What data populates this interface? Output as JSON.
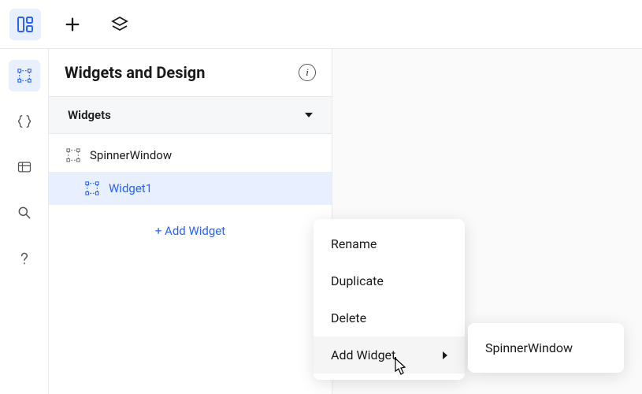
{
  "topbar": {
    "items": [
      {
        "name": "layout-icon",
        "active": true
      },
      {
        "name": "plus-icon",
        "active": false
      },
      {
        "name": "layers-icon",
        "active": false
      }
    ]
  },
  "sidebar": {
    "items": [
      {
        "name": "design-icon",
        "active": true
      },
      {
        "name": "code-icon",
        "active": false
      },
      {
        "name": "table-icon",
        "active": false
      },
      {
        "name": "search-icon",
        "active": false
      },
      {
        "name": "help-icon",
        "active": false
      }
    ]
  },
  "panel": {
    "title": "Widgets and Design",
    "info_char": "i",
    "section": {
      "title": "Widgets",
      "expanded": true
    },
    "tree": [
      {
        "label": "SpinnerWindow",
        "selected": false,
        "level": 0
      },
      {
        "label": "Widget1",
        "selected": true,
        "level": 1
      }
    ],
    "add_widget_label": "+ Add Widget"
  },
  "context_menu": {
    "items": [
      {
        "label": "Rename",
        "submenu": false,
        "hover": false
      },
      {
        "label": "Duplicate",
        "submenu": false,
        "hover": false
      },
      {
        "label": "Delete",
        "submenu": false,
        "hover": false
      },
      {
        "label": "Add Widget",
        "submenu": true,
        "hover": true
      }
    ]
  },
  "submenu": {
    "items": [
      {
        "label": "SpinnerWindow"
      }
    ]
  },
  "colors": {
    "accent": "#2962ff",
    "accent_bg": "#e8f0ff"
  }
}
